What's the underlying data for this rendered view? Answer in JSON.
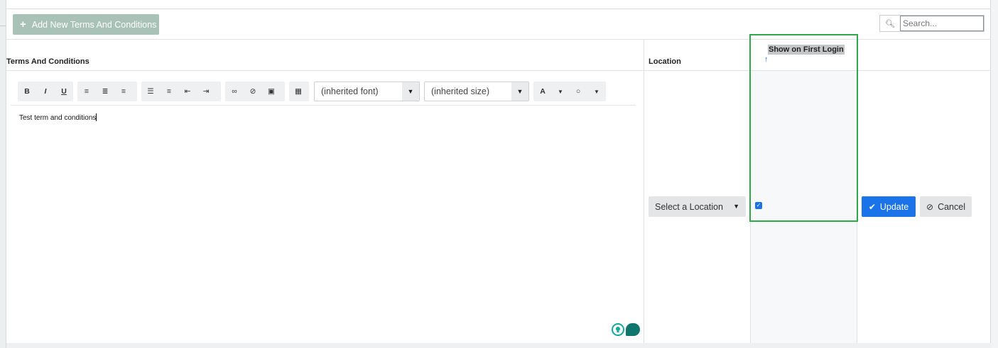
{
  "toolbar": {
    "add_label": "Add New Terms And Conditions",
    "add_icon": "plus-icon",
    "search_placeholder": "Search..."
  },
  "table": {
    "headers": {
      "terms": "Terms And Conditions",
      "location": "Location",
      "first_login": "Show on First Login"
    },
    "sort_indicator": "↑"
  },
  "editor": {
    "tools": [
      "bold",
      "italic",
      "underline",
      "align-left",
      "align-center",
      "align-right",
      "unordered-list",
      "ordered-list",
      "outdent",
      "indent",
      "link",
      "unlink",
      "image",
      "table"
    ],
    "labels": {
      "bold": "B",
      "italic": "I",
      "underline": "U",
      "text_color": "A"
    },
    "font_select": "(inherited font)",
    "size_select": "(inherited size)",
    "content": "Test term and conditions"
  },
  "row": {
    "location_select": "Select a Location",
    "show_on_first_login": true,
    "update_label": "Update",
    "cancel_label": "Cancel"
  },
  "colors": {
    "primary": "#1a73e8",
    "add_button": "#a9c2b8",
    "highlight": "#2ea84a"
  }
}
